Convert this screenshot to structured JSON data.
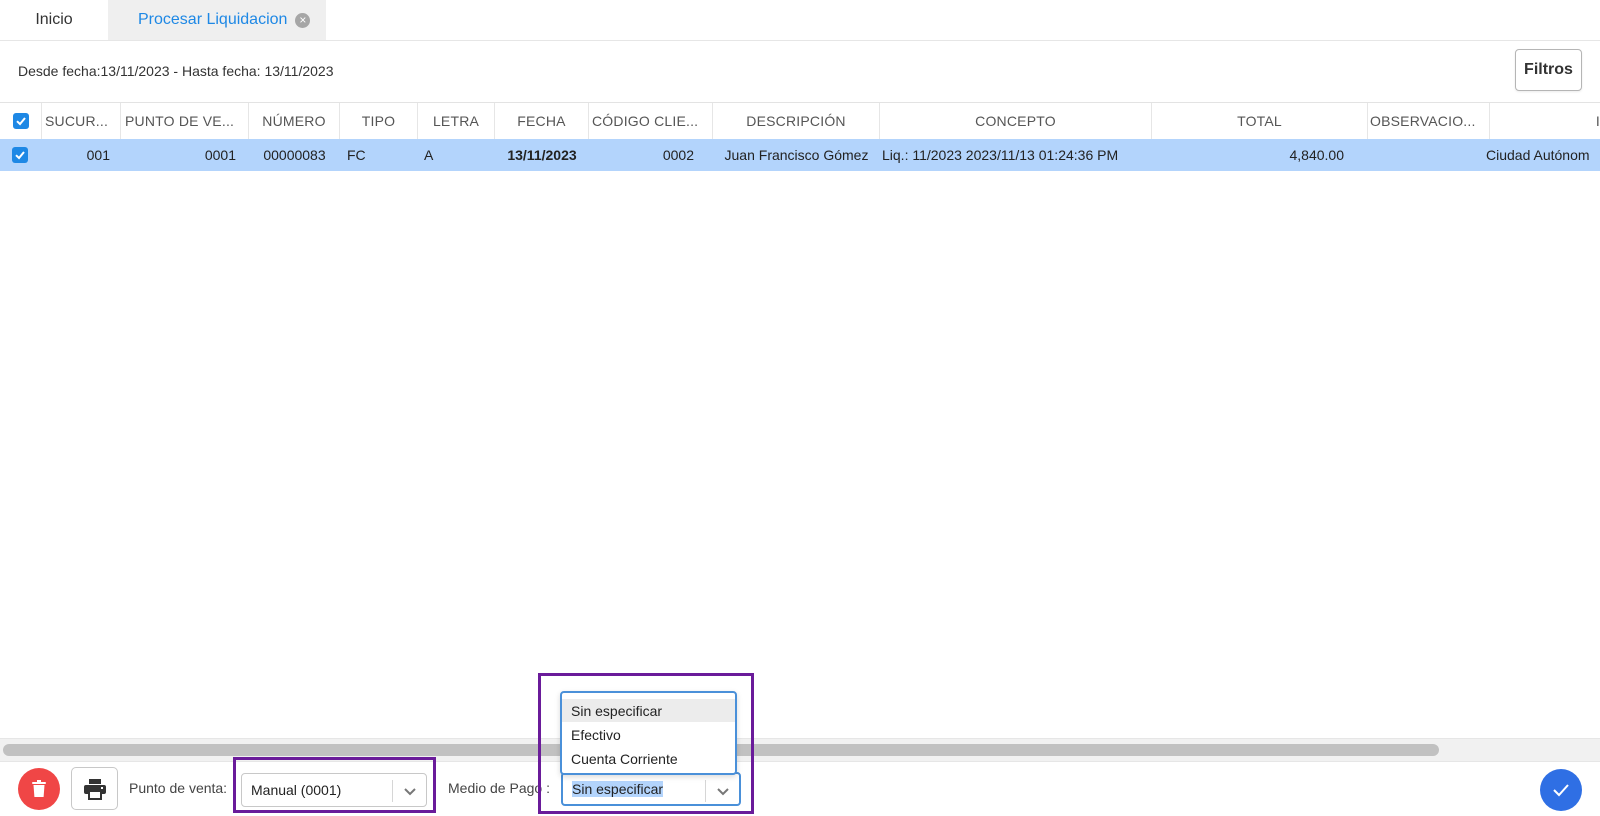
{
  "tabs": [
    {
      "label": "Inicio"
    },
    {
      "label": "Procesar Liquidacion"
    }
  ],
  "date_range": "Desde fecha:13/11/2023 - Hasta fecha: 13/11/2023",
  "filters_button": "Filtros",
  "table": {
    "columns": [
      "SUCUR...",
      "PUNTO DE VE...",
      "NÚMERO",
      "TIPO",
      "LETRA",
      "FECHA",
      "CÓDIGO CLIE...",
      "DESCRIPCIÓN",
      "CONCEPTO",
      "TOTAL",
      "OBSERVACIO...",
      "I"
    ],
    "rows": [
      {
        "selected": true,
        "sucursal": "001",
        "punto_venta": "0001",
        "numero": "00000083",
        "tipo": "FC",
        "letra": "A",
        "fecha": "13/11/2023",
        "codigo_cliente": "0002",
        "descripcion": "Juan Francisco Gómez",
        "concepto": "Liq.: 11/2023 2023/11/13 01:24:36 PM",
        "total": "4,840.00",
        "observaciones": "",
        "extra": "Ciudad Autónom"
      }
    ]
  },
  "footer": {
    "punto_venta_label": "Punto de venta:",
    "punto_venta_value": "Manual (0001)",
    "medio_pago_label": "Medio de Pago :",
    "medio_pago_value": "Sin especificar",
    "medio_pago_options": [
      "Sin especificar",
      "Efectivo",
      "Cuenta Corriente"
    ]
  },
  "colors": {
    "accent": "#1e88e5",
    "row_selected": "#b3d4fc",
    "highlight": "#6a1b9a",
    "delete": "#f04646",
    "confirm": "#2f6fe4"
  }
}
